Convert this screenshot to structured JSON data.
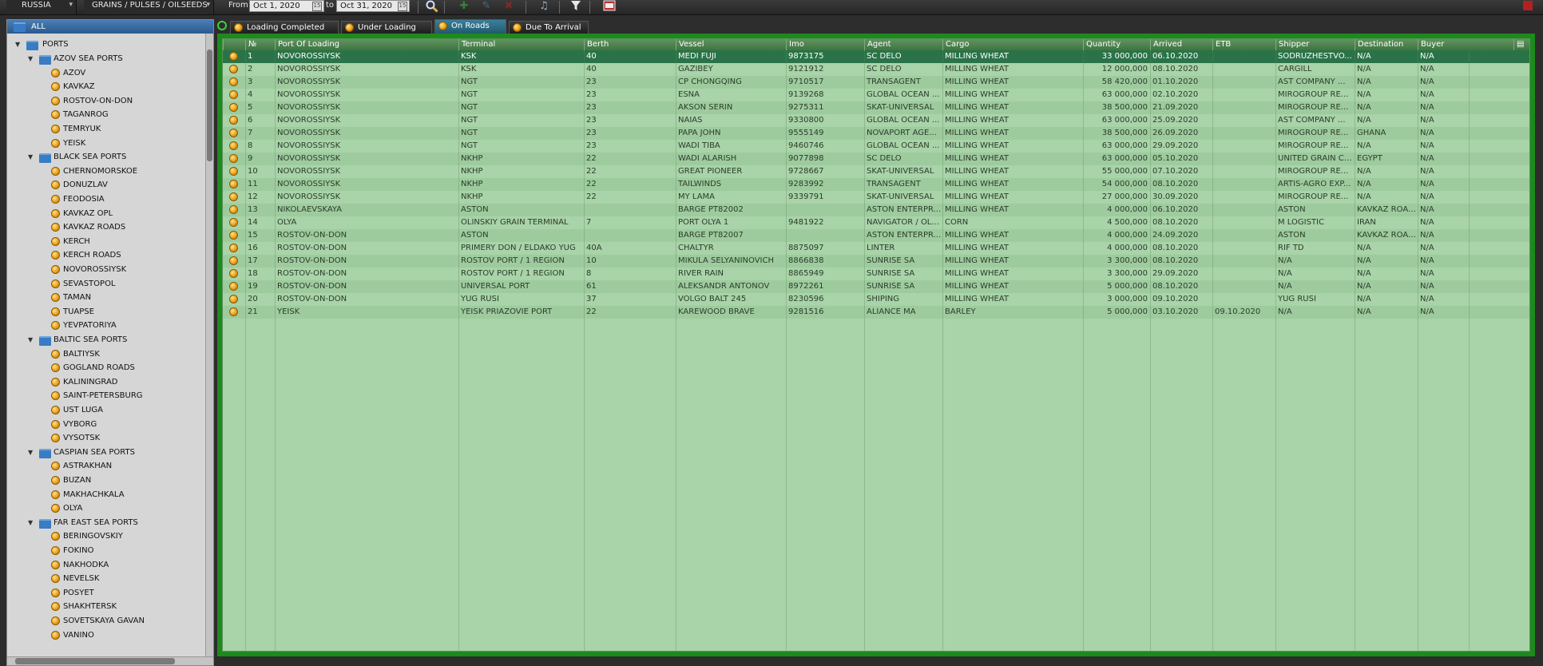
{
  "toolbar": {
    "country": "RUSSIA",
    "category": "GRAINS / PULSES / OILSEEDS",
    "from_label": "From",
    "from_date": "Oct 1, 2020",
    "to_label": "to",
    "to_date": "Oct 31, 2020"
  },
  "sidebar": {
    "root": "ALL",
    "ports_label": "PORTS",
    "groups": [
      {
        "name": "AZOV SEA PORTS",
        "items": [
          "AZOV",
          "KAVKAZ",
          "ROSTOV-ON-DON",
          "TAGANROG",
          "TEMRYUK",
          "YEISK"
        ]
      },
      {
        "name": "BLACK SEA PORTS",
        "items": [
          "CHERNOMORSKOE",
          "DONUZLAV",
          "FEODOSIA",
          "KAVKAZ OPL",
          "KAVKAZ ROADS",
          "KERCH",
          "KERCH ROADS",
          "NOVOROSSIYSK",
          "SEVASTOPOL",
          "TAMAN",
          "TUAPSE",
          "YEVPATORIYA"
        ]
      },
      {
        "name": "BALTIC SEA PORTS",
        "items": [
          "BALTIYSK",
          "GOGLAND ROADS",
          "KALININGRAD",
          "SAINT-PETERSBURG",
          "UST LUGA",
          "VYBORG",
          "VYSOTSK"
        ]
      },
      {
        "name": "CASPIAN SEA PORTS",
        "items": [
          "ASTRAKHAN",
          "BUZAN",
          "MAKHACHKALA",
          "OLYA"
        ]
      },
      {
        "name": "FAR EAST SEA PORTS",
        "items": [
          "BERINGOVSKIY",
          "FOKINO",
          "NAKHODKA",
          "NEVELSK",
          "POSYET",
          "SHAKHTERSK",
          "SOVETSKAYA GAVAN",
          "VANINO"
        ]
      }
    ]
  },
  "tabs": [
    {
      "label": "Loading Completed",
      "active": false
    },
    {
      "label": "Under Loading",
      "active": false
    },
    {
      "label": "On Roads",
      "active": true
    },
    {
      "label": "Due To Arrival",
      "active": false
    }
  ],
  "grid": {
    "columns": [
      "№",
      "Port Of Loading",
      "Terminal",
      "Berth",
      "Vessel",
      "Imo",
      "Agent",
      "Cargo",
      "Quantity",
      "Arrived",
      "ETB",
      "Shipper",
      "Destination",
      "Buyer"
    ],
    "rows": [
      [
        "1",
        "NOVOROSSIYSK",
        "KSK",
        "40",
        "MEDI FUJI",
        "9873175",
        "SC DELO",
        "MILLING WHEAT",
        "33 000,000",
        "06.10.2020",
        "",
        "SODRUZHESTVO...",
        "N/A",
        "N/A"
      ],
      [
        "2",
        "NOVOROSSIYSK",
        "KSK",
        "40",
        "GAZIBEY",
        "9121912",
        "SC DELO",
        "MILLING WHEAT",
        "12 000,000",
        "08.10.2020",
        "",
        "CARGILL",
        "N/A",
        "N/A"
      ],
      [
        "3",
        "NOVOROSSIYSK",
        "NGT",
        "23",
        "CP CHONGQING",
        "9710517",
        "TRANSAGENT",
        "MILLING WHEAT",
        "58 420,000",
        "01.10.2020",
        "",
        "AST COMPANY ...",
        "N/A",
        "N/A"
      ],
      [
        "4",
        "NOVOROSSIYSK",
        "NGT",
        "23",
        "ESNA",
        "9139268",
        "GLOBAL OCEAN ...",
        "MILLING WHEAT",
        "63 000,000",
        "02.10.2020",
        "",
        "MIROGROUP RE...",
        "N/A",
        "N/A"
      ],
      [
        "5",
        "NOVOROSSIYSK",
        "NGT",
        "23",
        "AKSON SERIN",
        "9275311",
        "SKAT-UNIVERSAL",
        "MILLING WHEAT",
        "38 500,000",
        "21.09.2020",
        "",
        "MIROGROUP RE...",
        "N/A",
        "N/A"
      ],
      [
        "6",
        "NOVOROSSIYSK",
        "NGT",
        "23",
        "NAIAS",
        "9330800",
        "GLOBAL OCEAN ...",
        "MILLING WHEAT",
        "63 000,000",
        "25.09.2020",
        "",
        "AST COMPANY ...",
        "N/A",
        "N/A"
      ],
      [
        "7",
        "NOVOROSSIYSK",
        "NGT",
        "23",
        "PAPA JOHN",
        "9555149",
        "NOVAPORT AGE...",
        "MILLING WHEAT",
        "38 500,000",
        "26.09.2020",
        "",
        "MIROGROUP RE...",
        "GHANA",
        "N/A"
      ],
      [
        "8",
        "NOVOROSSIYSK",
        "NGT",
        "23",
        "WADI TIBA",
        "9460746",
        "GLOBAL OCEAN ...",
        "MILLING WHEAT",
        "63 000,000",
        "29.09.2020",
        "",
        "MIROGROUP RE...",
        "N/A",
        "N/A"
      ],
      [
        "9",
        "NOVOROSSIYSK",
        "NKHP",
        "22",
        "WADI ALARISH",
        "9077898",
        "SC DELO",
        "MILLING WHEAT",
        "63 000,000",
        "05.10.2020",
        "",
        "UNITED GRAIN C...",
        "EGYPT",
        "N/A"
      ],
      [
        "10",
        "NOVOROSSIYSK",
        "NKHP",
        "22",
        "GREAT PIONEER",
        "9728667",
        "SKAT-UNIVERSAL",
        "MILLING WHEAT",
        "55 000,000",
        "07.10.2020",
        "",
        "MIROGROUP RE...",
        "N/A",
        "N/A"
      ],
      [
        "11",
        "NOVOROSSIYSK",
        "NKHP",
        "22",
        "TAILWINDS",
        "9283992",
        "TRANSAGENT",
        "MILLING WHEAT",
        "54 000,000",
        "08.10.2020",
        "",
        "ARTIS-AGRO EXP...",
        "N/A",
        "N/A"
      ],
      [
        "12",
        "NOVOROSSIYSK",
        "NKHP",
        "22",
        "MY LAMA",
        "9339791",
        "SKAT-UNIVERSAL",
        "MILLING WHEAT",
        "27 000,000",
        "30.09.2020",
        "",
        "MIROGROUP RE...",
        "N/A",
        "N/A"
      ],
      [
        "13",
        "NIKOLAEVSKAYA",
        "ASTON",
        "",
        "BARGE PT82002",
        "",
        "ASTON ENTERPR...",
        "MILLING WHEAT",
        "4 000,000",
        "06.10.2020",
        "",
        "ASTON",
        "KAVKAZ ROADS",
        "N/A"
      ],
      [
        "14",
        "OLYA",
        "OLINSKIY GRAIN TERMINAL",
        "7",
        "PORT OLYA 1",
        "9481922",
        "NAVIGATOR / OL...",
        "CORN",
        "4 500,000",
        "08.10.2020",
        "",
        "M LOGISTIC",
        "IRAN",
        "N/A"
      ],
      [
        "15",
        "ROSTOV-ON-DON",
        "ASTON",
        "",
        "BARGE PT82007",
        "",
        "ASTON ENTERPR...",
        "MILLING WHEAT",
        "4 000,000",
        "24.09.2020",
        "",
        "ASTON",
        "KAVKAZ ROADS",
        "N/A"
      ],
      [
        "16",
        "ROSTOV-ON-DON",
        "PRIMERY DON / ELDAKO YUG",
        "40A",
        "CHALTYR",
        "8875097",
        "LINTER",
        "MILLING WHEAT",
        "4 000,000",
        "08.10.2020",
        "",
        "RIF TD",
        "N/A",
        "N/A"
      ],
      [
        "17",
        "ROSTOV-ON-DON",
        "ROSTOV PORT / 1 REGION",
        "10",
        "MIKULA SELYANINOVICH",
        "8866838",
        "SUNRISE SA",
        "MILLING WHEAT",
        "3 300,000",
        "08.10.2020",
        "",
        "N/A",
        "N/A",
        "N/A"
      ],
      [
        "18",
        "ROSTOV-ON-DON",
        "ROSTOV PORT / 1 REGION",
        "8",
        "RIVER RAIN",
        "8865949",
        "SUNRISE SA",
        "MILLING WHEAT",
        "3 300,000",
        "29.09.2020",
        "",
        "N/A",
        "N/A",
        "N/A"
      ],
      [
        "19",
        "ROSTOV-ON-DON",
        "UNIVERSAL PORT",
        "61",
        "ALEKSANDR ANTONOV",
        "8972261",
        "SUNRISE SA",
        "MILLING WHEAT",
        "5 000,000",
        "08.10.2020",
        "",
        "N/A",
        "N/A",
        "N/A"
      ],
      [
        "20",
        "ROSTOV-ON-DON",
        "YUG RUSI",
        "37",
        "VOLGO BALT 245",
        "8230596",
        "SHIPING",
        "MILLING WHEAT",
        "3 000,000",
        "09.10.2020",
        "",
        "YUG RUSI",
        "N/A",
        "N/A"
      ],
      [
        "21",
        "YEISK",
        "YEISK PRIAZOVIE PORT",
        "22",
        "KAREWOOD BRAVE",
        "9281516",
        "ALIANCE MA",
        "BARLEY",
        "5 000,000",
        "03.10.2020",
        "09.10.2020",
        "N/A",
        "N/A",
        "N/A"
      ]
    ],
    "selected_row": 0
  },
  "colors": {
    "accent_green": "#1c8a1c",
    "grid_bg": "#a9d3a9",
    "selected_row": "#2a7348",
    "active_tab": "#2f6f86"
  }
}
